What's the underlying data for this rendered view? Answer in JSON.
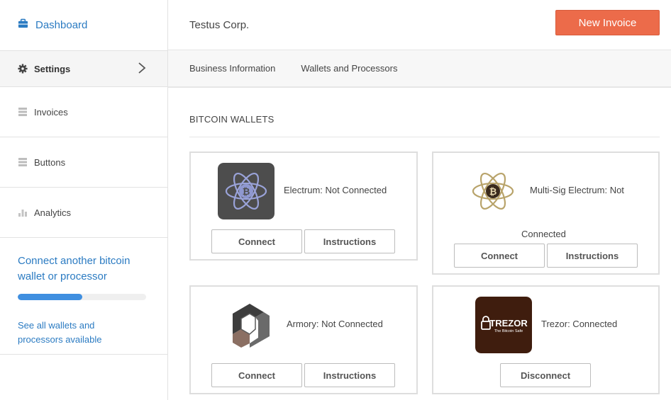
{
  "sidebar": {
    "dashboard": "Dashboard",
    "settings": "Settings",
    "items": [
      {
        "label": "Invoices"
      },
      {
        "label": "Buttons"
      },
      {
        "label": "Analytics"
      }
    ],
    "cta": {
      "title": "Connect another bitcoin wallet or processor",
      "progress_percent": 50,
      "link": "See all wallets and processors available"
    }
  },
  "header": {
    "company": "Testus Corp.",
    "new_invoice": "New Invoice"
  },
  "subnav": {
    "tabs": [
      "Business Information",
      "Wallets and Processors"
    ]
  },
  "section": {
    "title": "BITCOIN WALLETS"
  },
  "wallets": [
    {
      "name": "Electrum",
      "status": "Electrum: Not Connected",
      "buttons": [
        "Connect",
        "Instructions"
      ]
    },
    {
      "name": "Multi-Sig Electrum",
      "status_line1": "Multi-Sig Electrum: Not",
      "status_line2": "Connected",
      "buttons": [
        "Connect",
        "Instructions"
      ]
    },
    {
      "name": "Armory",
      "status": "Armory: Not Connected",
      "buttons": [
        "Connect",
        "Instructions"
      ]
    },
    {
      "name": "Trezor",
      "status": "Trezor: Connected",
      "logo_text": "TREZOR",
      "logo_subtext": "The Bitcoin Safe",
      "buttons": [
        "Disconnect"
      ]
    }
  ],
  "colors": {
    "accent": "#2b7bc2",
    "primary_button": "#ec6b4a",
    "progress": "#3f8fe0",
    "electrum_tile": "#4d4d4d",
    "trezor_tile": "#3f1d0e"
  }
}
